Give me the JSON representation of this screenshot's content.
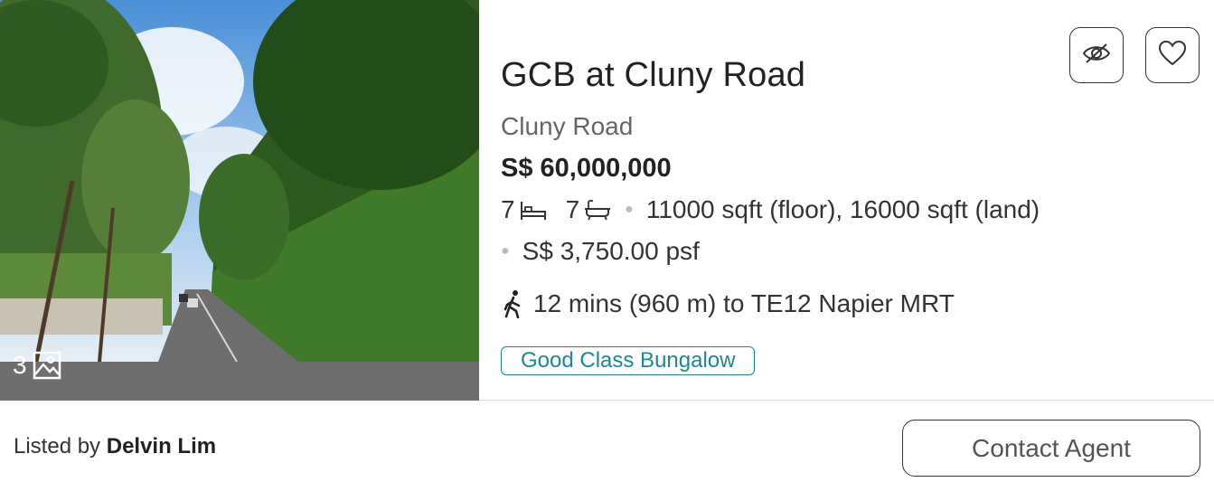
{
  "listing": {
    "photo_count": "3",
    "title": "GCB at Cluny Road",
    "street": "Cluny Road",
    "price": "S$ 60,000,000",
    "beds": "7",
    "baths": "7",
    "area": "11000 sqft (floor), 16000 sqft (land)",
    "psf": "S$ 3,750.00 psf",
    "mrt": "12 mins (960 m) to TE12 Napier MRT",
    "tag": "Good Class Bungalow"
  },
  "footer": {
    "listed_by_label": "Listed by",
    "agent_name": "Delvin Lim",
    "contact_label": "Contact Agent"
  },
  "icons": {
    "hide": "eye-slash-icon",
    "favorite": "heart-icon",
    "gallery": "image-icon",
    "bed": "bed-icon",
    "bath": "bathtub-icon",
    "walk": "walking-person-icon"
  },
  "colors": {
    "tag_accent": "#1a8a8f",
    "text_dark": "#222222",
    "text_muted": "#666666"
  }
}
